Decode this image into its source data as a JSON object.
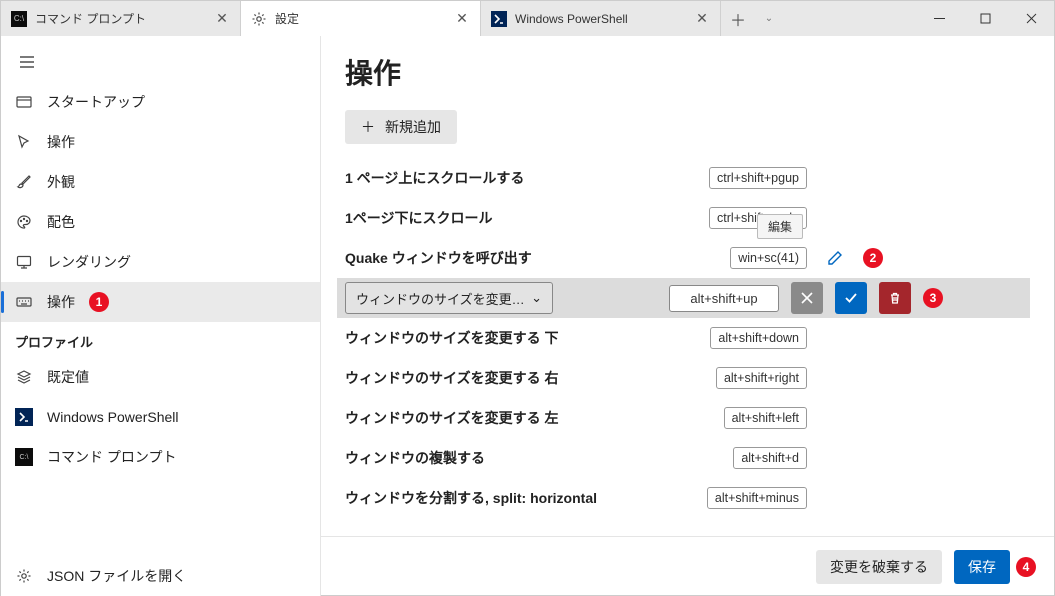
{
  "tabs": [
    {
      "label": "コマンド プロンプト"
    },
    {
      "label": "設定"
    },
    {
      "label": "Windows PowerShell"
    }
  ],
  "sidebar": {
    "items": [
      {
        "label": "スタートアップ"
      },
      {
        "label": "操作"
      },
      {
        "label": "外観"
      },
      {
        "label": "配色"
      },
      {
        "label": "レンダリング"
      },
      {
        "label": "操作"
      }
    ],
    "profile_header": "プロファイル",
    "profiles": [
      {
        "label": "既定値"
      },
      {
        "label": "Windows PowerShell"
      },
      {
        "label": "コマンド プロンプト"
      }
    ],
    "open_json": "JSON ファイルを開く"
  },
  "page": {
    "title": "操作",
    "add_new": "新規追加",
    "edit_tooltip": "編集"
  },
  "actions": [
    {
      "label": "1 ページ上にスクロールする",
      "key": "ctrl+shift+pgup"
    },
    {
      "label": "1ページ下にスクロール",
      "key": "ctrl+shift+pgdn"
    },
    {
      "label": "Quake ウィンドウを呼び出す",
      "key": "win+sc(41)"
    },
    {
      "label": "ウィンドウのサイズを変更する 上",
      "key": "alt+shift+up"
    },
    {
      "label": "ウィンドウのサイズを変更する 下",
      "key": "alt+shift+down"
    },
    {
      "label": "ウィンドウのサイズを変更する 右",
      "key": "alt+shift+right"
    },
    {
      "label": "ウィンドウのサイズを変更する 左",
      "key": "alt+shift+left"
    },
    {
      "label": "ウィンドウの複製する",
      "key": "alt+shift+d"
    },
    {
      "label": "ウィンドウを分割する, split: horizontal",
      "key": "alt+shift+minus"
    }
  ],
  "footer": {
    "discard": "変更を破棄する",
    "save": "保存"
  },
  "callouts": {
    "one": "1",
    "two": "2",
    "three": "3",
    "four": "4"
  }
}
